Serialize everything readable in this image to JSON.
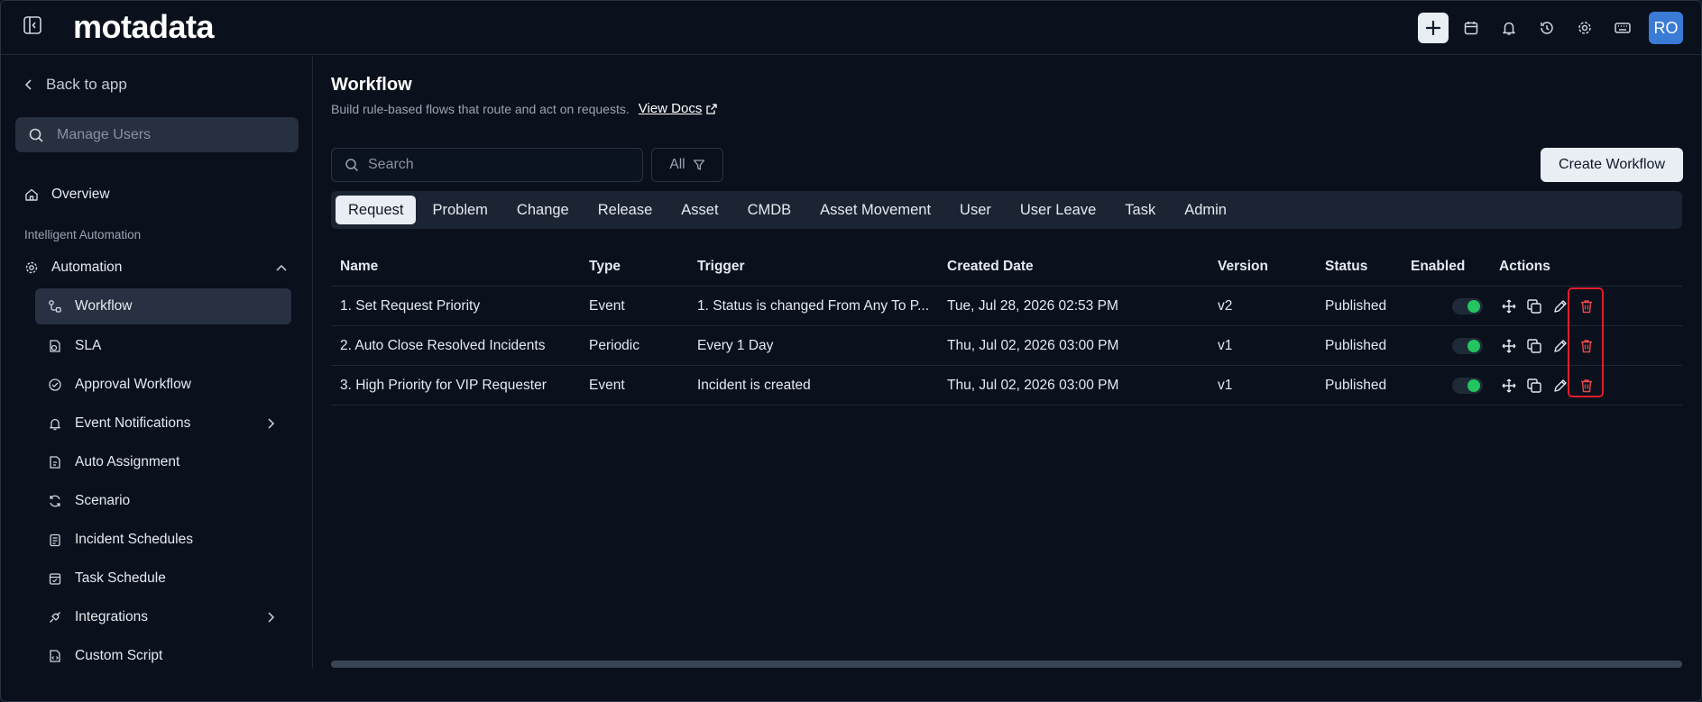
{
  "app": {
    "logo_text": "motadata",
    "avatar_initials": "RO"
  },
  "topbar": {
    "icons": [
      "plus-icon",
      "calendar-icon",
      "bell-icon",
      "history-icon",
      "gear-icon",
      "keyboard-icon"
    ]
  },
  "sidebar": {
    "back_label": "Back to app",
    "search_placeholder": "Manage Users",
    "overview_label": "Overview",
    "section_label": "Intelligent Automation",
    "automation_label": "Automation",
    "items": [
      {
        "label": "Workflow"
      },
      {
        "label": "SLA"
      },
      {
        "label": "Approval Workflow"
      },
      {
        "label": "Event Notifications"
      },
      {
        "label": "Auto Assignment"
      },
      {
        "label": "Scenario"
      },
      {
        "label": "Incident Schedules"
      },
      {
        "label": "Task Schedule"
      },
      {
        "label": "Integrations"
      },
      {
        "label": "Custom Script"
      }
    ]
  },
  "main": {
    "title": "Workflow",
    "subtitle": "Build rule-based flows that route and act on requests.",
    "view_docs": "View Docs",
    "search_placeholder": "Search",
    "filter_label": "All",
    "create_label": "Create Workflow",
    "tabs": [
      "Request",
      "Problem",
      "Change",
      "Release",
      "Asset",
      "CMDB",
      "Asset Movement",
      "User",
      "User Leave",
      "Task",
      "Admin"
    ],
    "active_tab": "Request",
    "columns": [
      "Name",
      "Type",
      "Trigger",
      "Created Date",
      "Version",
      "Status",
      "Enabled",
      "Actions"
    ],
    "rows": [
      {
        "name": "1. Set Request Priority",
        "type": "Event",
        "trigger": "1. Status is changed From Any To P...",
        "created": "Tue, Jul 28, 2026 02:53 PM",
        "version": "v2",
        "status": "Published",
        "enabled": true
      },
      {
        "name": "2. Auto Close Resolved Incidents",
        "type": "Periodic",
        "trigger": "Every 1 Day",
        "created": "Thu, Jul 02, 2026 03:00 PM",
        "version": "v1",
        "status": "Published",
        "enabled": true
      },
      {
        "name": "3. High Priority for VIP Requester",
        "type": "Event",
        "trigger": "Incident is created",
        "created": "Thu, Jul 02, 2026 03:00 PM",
        "version": "v1",
        "status": "Published",
        "enabled": true
      }
    ]
  },
  "colors": {
    "background": "#0a101c",
    "accent": "#3a7bd5",
    "toggle_on": "#22c55e",
    "delete": "#e5484d",
    "highlight": "#e11d2a"
  }
}
